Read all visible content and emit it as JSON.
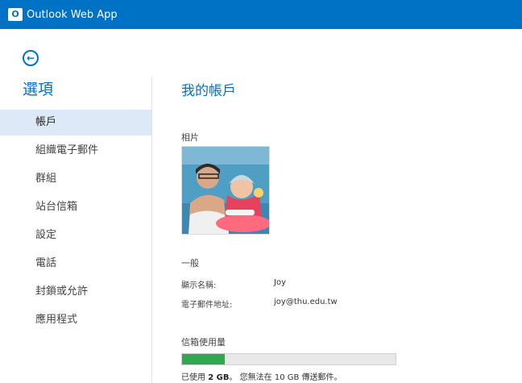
{
  "app": {
    "logo_text": "O",
    "title": "Outlook Web App",
    "brand_color": "#0072c6"
  },
  "sidebar": {
    "title": "選項",
    "items": [
      {
        "label": "帳戶",
        "selected": true
      },
      {
        "label": "組織電子郵件",
        "selected": false
      },
      {
        "label": "群組",
        "selected": false
      },
      {
        "label": "站台信箱",
        "selected": false
      },
      {
        "label": "設定",
        "selected": false
      },
      {
        "label": "電話",
        "selected": false
      },
      {
        "label": "封鎖或允許",
        "selected": false
      },
      {
        "label": "應用程式",
        "selected": false
      }
    ]
  },
  "main": {
    "title": "我的帳戶",
    "photo_label": "相片",
    "general_label": "一般",
    "display_name_label": "顯示名稱:",
    "display_name": "Joy",
    "email_label": "電子郵件地址:",
    "email": "joy@thu.edu.tw",
    "mailbox_usage_label": "信箱使用量",
    "usage": {
      "fill_fraction": 0.2,
      "prefix": "已使用 ",
      "used": "2 GB",
      "suffix": "。 您無法在 10 GB 傳送郵件。"
    }
  }
}
